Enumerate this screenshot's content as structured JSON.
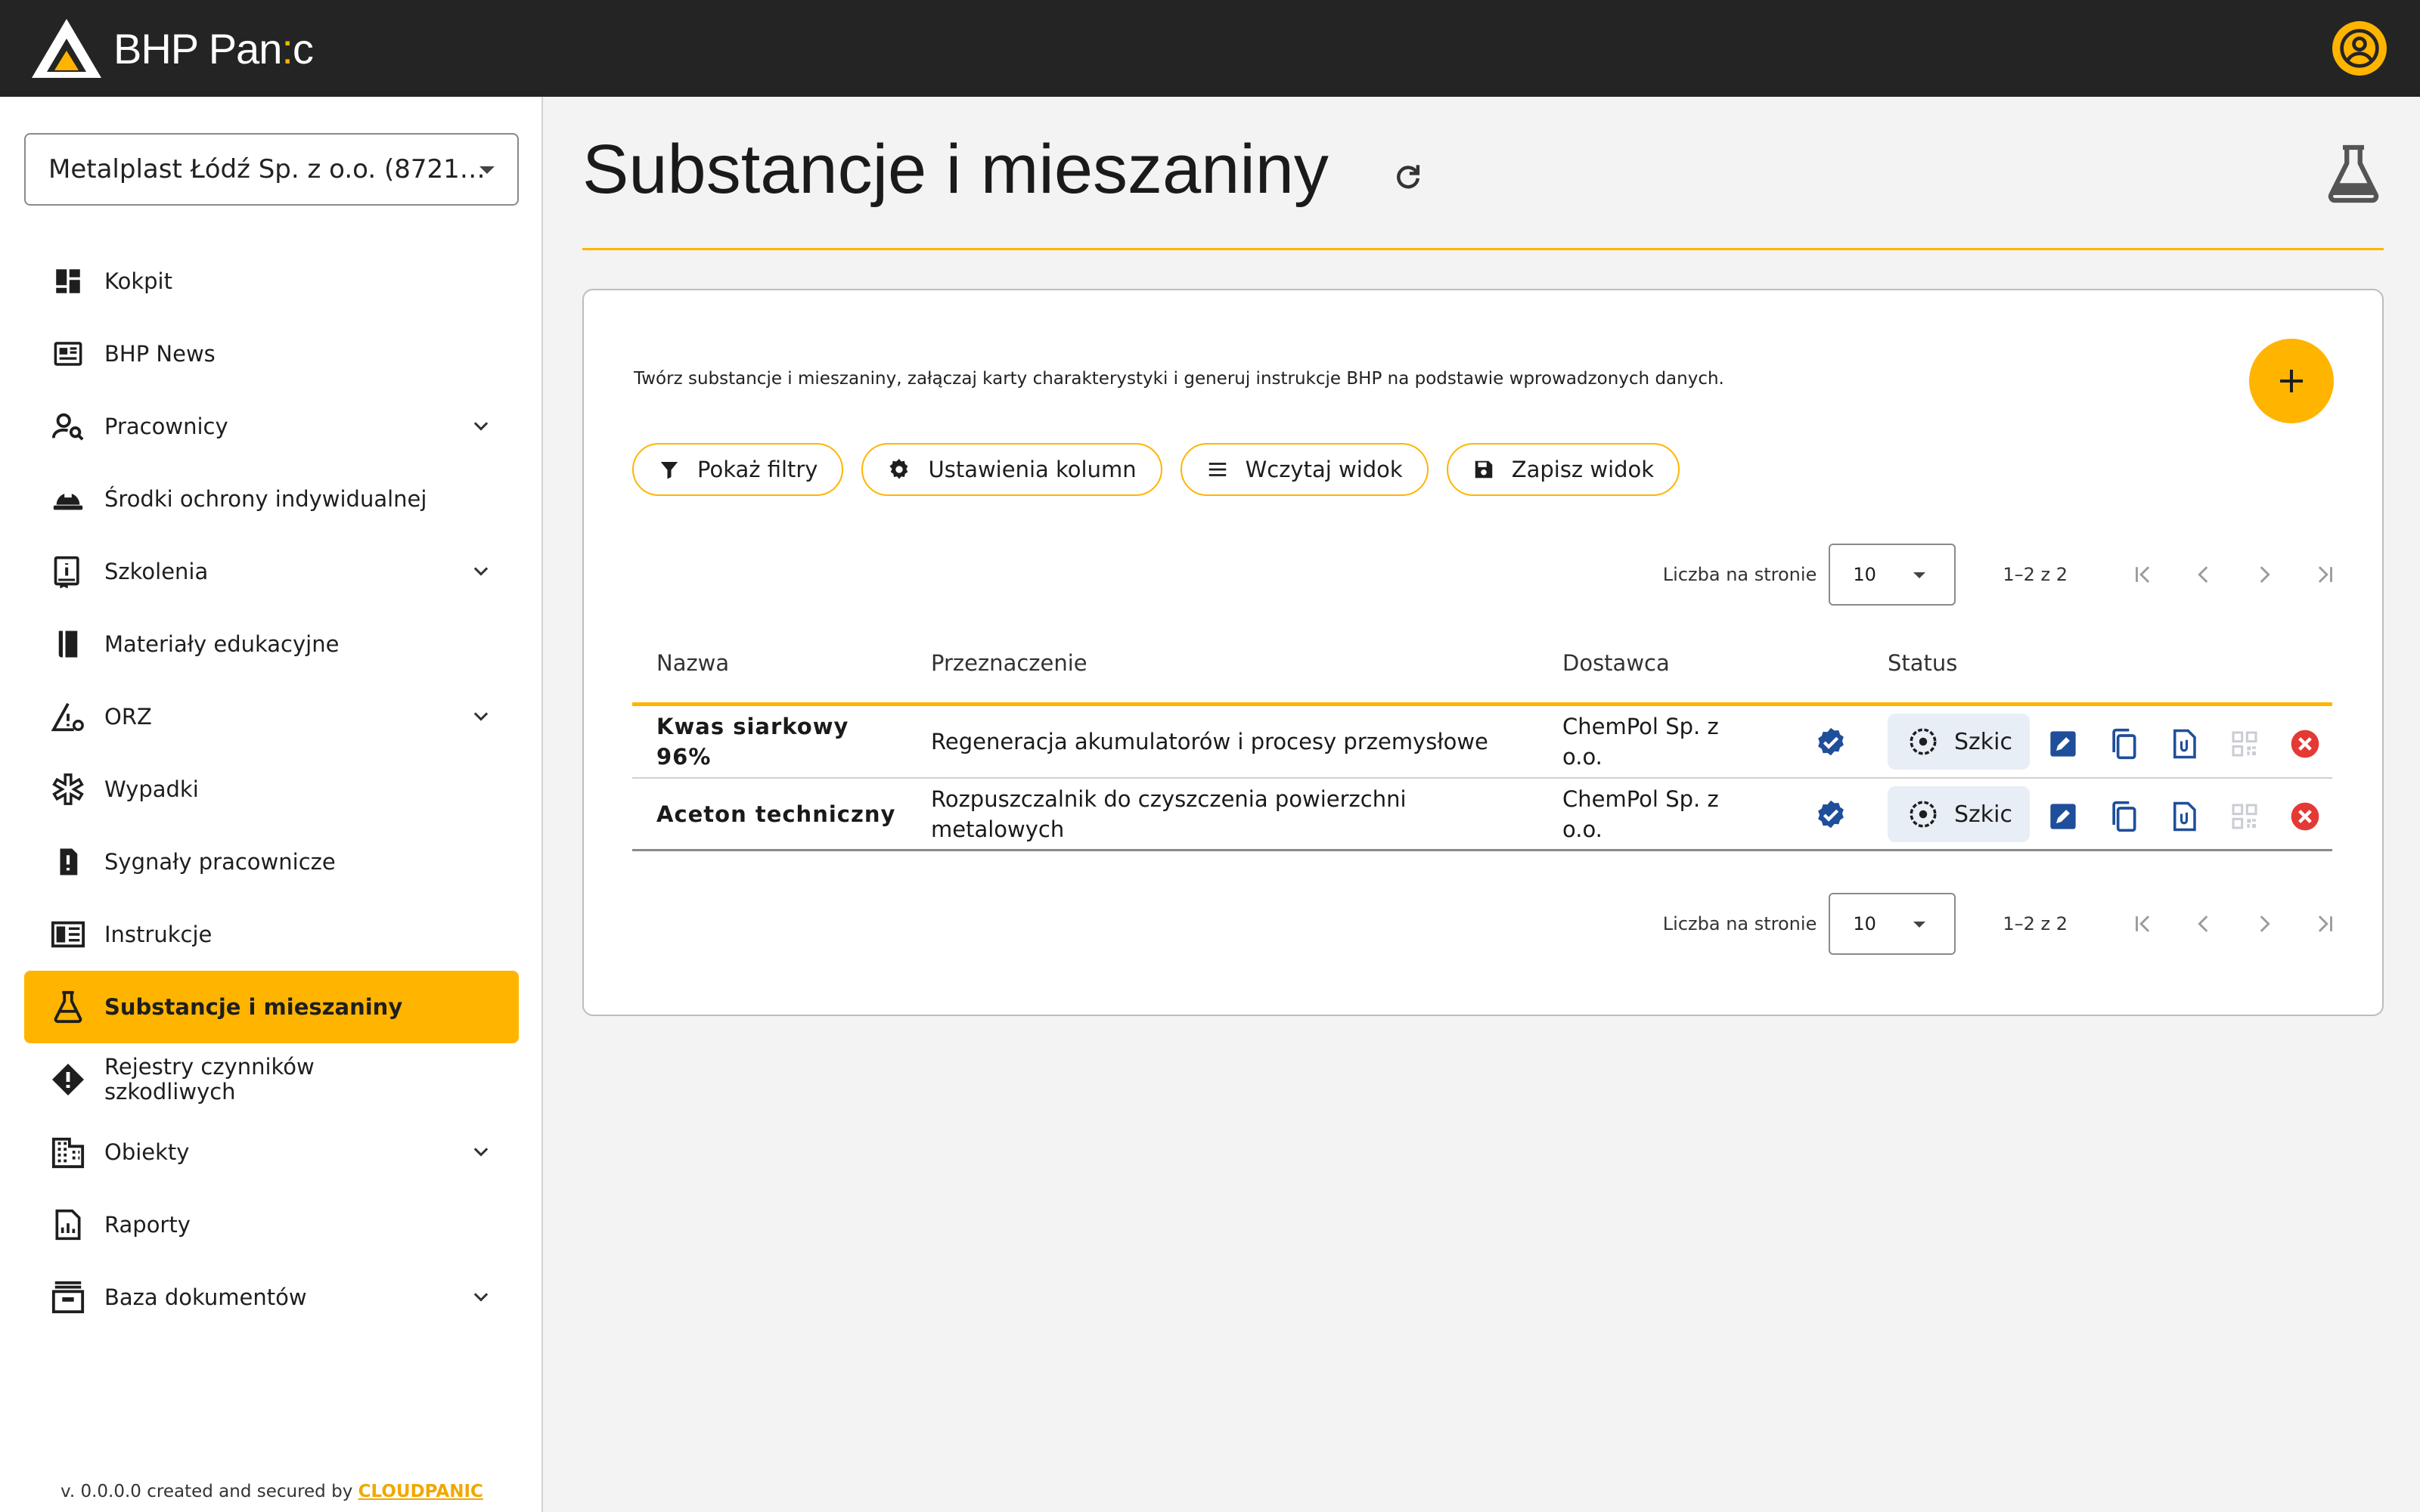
{
  "app": {
    "logo_text_a": "BHP Pan",
    "logo_text_colon": ":",
    "logo_text_b": "c"
  },
  "sidebar": {
    "company": "Metalplast Łódź Sp. z o.o. (8721…",
    "items": [
      {
        "label": "Kokpit",
        "icon": "dashboard-icon",
        "expandable": false
      },
      {
        "label": "BHP News",
        "icon": "news-icon",
        "expandable": false
      },
      {
        "label": "Pracownicy",
        "icon": "people-search-icon",
        "expandable": true
      },
      {
        "label": "Środki ochrony indywidualnej",
        "icon": "helmet-icon",
        "expandable": false
      },
      {
        "label": "Szkolenia",
        "icon": "training-book-icon",
        "expandable": true
      },
      {
        "label": "Materiały edukacyjne",
        "icon": "book-icon",
        "expandable": false
      },
      {
        "label": "ORZ",
        "icon": "risk-warning-icon",
        "expandable": true
      },
      {
        "label": "Wypadki",
        "icon": "medical-star-icon",
        "expandable": false
      },
      {
        "label": "Sygnały pracownicze",
        "icon": "report-signal-icon",
        "expandable": false
      },
      {
        "label": "Instrukcje",
        "icon": "instructions-icon",
        "expandable": false
      },
      {
        "label": "Substancje i mieszaniny",
        "icon": "flask-icon",
        "expandable": false,
        "active": true
      },
      {
        "label": "Rejestry czynników szkodliwych",
        "icon": "alert-diamond-icon",
        "expandable": false
      },
      {
        "label": "Obiekty",
        "icon": "building-icon",
        "expandable": true
      },
      {
        "label": "Raporty",
        "icon": "report-chart-icon",
        "expandable": false
      },
      {
        "label": "Baza dokumentów",
        "icon": "archive-icon",
        "expandable": true
      }
    ],
    "footer_prefix": "v. 0.0.0.0 created and secured by ",
    "footer_brand": "CLOUDPANIC"
  },
  "main": {
    "title": "Substancje i mieszaniny",
    "description": "Twórz substancje i mieszaniny, załączaj karty charakterystyki i generuj instrukcje BHP na podstawie wprowadzonych danych.",
    "chips": [
      {
        "label": "Pokaż filtry",
        "icon": "filter-icon"
      },
      {
        "label": "Ustawienia kolumn",
        "icon": "gear-icon"
      },
      {
        "label": "Wczytaj widok",
        "icon": "list-icon"
      },
      {
        "label": "Zapisz widok",
        "icon": "save-icon"
      }
    ],
    "pager": {
      "label": "Liczba na stronie",
      "per_page": "10",
      "range": "1–2 z 2"
    },
    "table": {
      "headers": {
        "name": "Nazwa",
        "purpose": "Przeznaczenie",
        "supplier": "Dostawca",
        "status": "Status"
      },
      "rows": [
        {
          "name": "Kwas siarkowy 96%",
          "purpose": "Regeneracja akumulatorów i procesy przemysłowe",
          "supplier": "ChemPol Sp. z o.o.",
          "status": "Szkic"
        },
        {
          "name": "Aceton techniczny",
          "purpose": "Rozpuszczalnik do czyszczenia powierzchni metalowych",
          "supplier": "ChemPol Sp. z o.o.",
          "status": "Szkic"
        }
      ]
    }
  },
  "colors": {
    "accent": "#ffb400",
    "topbar": "#242424",
    "action_blue": "#1f4e9a",
    "danger": "#e53935"
  }
}
